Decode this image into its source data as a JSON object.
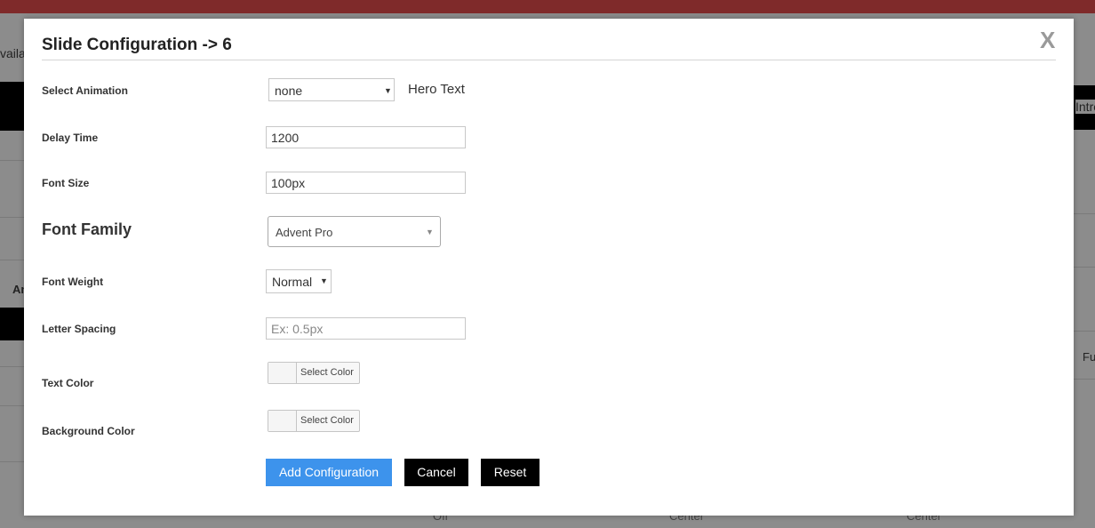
{
  "background": {
    "left_text": "vailab",
    "left_an": "An",
    "right_intro": "Intro",
    "right_fu": "Fu",
    "bottom_texts": [
      "Off",
      "Center",
      "Center"
    ]
  },
  "modal": {
    "title": "Slide Configuration -> 6",
    "close_label": "X",
    "fields": {
      "animation": {
        "label": "Select Animation",
        "value": "none",
        "hint": "Hero Text"
      },
      "delay": {
        "label": "Delay Time",
        "value": "1200"
      },
      "font_size": {
        "label": "Font Size",
        "value": "100px"
      },
      "font_family": {
        "label": "Font Family",
        "value": "Advent Pro"
      },
      "font_weight": {
        "label": "Font Weight",
        "value": "Normal"
      },
      "letter_spacing": {
        "label": "Letter Spacing",
        "value": "",
        "placeholder": "Ex: 0.5px"
      },
      "text_color": {
        "label": "Text Color",
        "button": "Select Color"
      },
      "background_color": {
        "label": "Background Color",
        "button": "Select Color"
      }
    },
    "buttons": {
      "add": "Add Configuration",
      "cancel": "Cancel",
      "reset": "Reset"
    }
  },
  "colors": {
    "top_bar": "#7f2a2a",
    "primary_button": "#3d93ec",
    "dark_button": "#000000"
  }
}
